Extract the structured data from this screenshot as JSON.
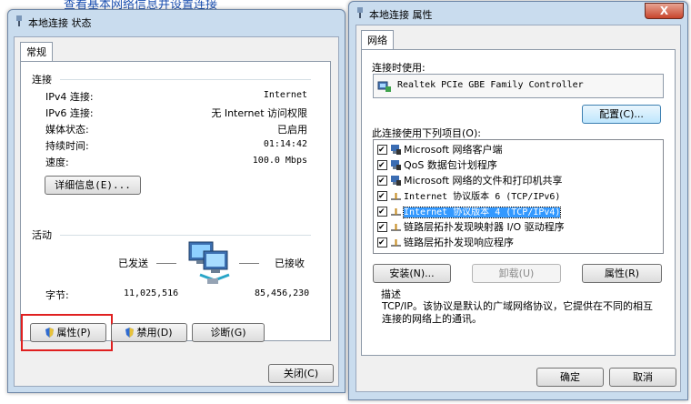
{
  "background": {
    "link_text": "查看基本网络信息并设置连接"
  },
  "status_window": {
    "title": "本地连接 状态",
    "tab": "常规",
    "connection_section": "连接",
    "rows": [
      {
        "label": "IPv4 连接:",
        "value": "Internet"
      },
      {
        "label": "IPv6 连接:",
        "value": "无 Internet 访问权限"
      },
      {
        "label": "媒体状态:",
        "value": "已启用"
      },
      {
        "label": "持续时间:",
        "value": "01:14:42"
      },
      {
        "label": "速度:",
        "value": "100.0 Mbps"
      }
    ],
    "details_button": "详细信息(E)...",
    "activity_section": "活动",
    "sent_label": "已发送",
    "received_label": "已接收",
    "bytes_label": "字节:",
    "bytes_sent": "11,025,516",
    "bytes_received": "85,456,230",
    "properties_button": "属性(P)",
    "disable_button": "禁用(D)",
    "diagnose_button": "诊断(G)",
    "close_button": "关闭(C)"
  },
  "properties_window": {
    "title": "本地连接 属性",
    "close_glyph": "X",
    "tab": "网络",
    "connect_using_label": "连接时使用:",
    "adapter_name": "Realtek PCIe GBE Family Controller",
    "configure_button": "配置(C)...",
    "items_label": "此连接使用下列项目(O):",
    "items": [
      {
        "label": "Microsoft 网络客户端",
        "icon": "network-client-icon",
        "checked": true
      },
      {
        "label": "QoS 数据包计划程序",
        "icon": "qos-icon",
        "checked": true
      },
      {
        "label": "Microsoft 网络的文件和打印机共享",
        "icon": "file-printer-sharing-icon",
        "checked": true
      },
      {
        "label": "Internet 协议版本 6 (TCP/IPv6)",
        "icon": "protocol-icon",
        "checked": true
      },
      {
        "label": "Internet 协议版本 4 (TCP/IPv4)",
        "icon": "protocol-icon",
        "checked": true,
        "selected": true
      },
      {
        "label": "链路层拓扑发现映射器 I/O 驱动程序",
        "icon": "protocol-icon",
        "checked": true
      },
      {
        "label": "链路层拓扑发现响应程序",
        "icon": "protocol-icon",
        "checked": true
      }
    ],
    "install_button": "安装(N)...",
    "uninstall_button": "卸载(U)",
    "properties_button": "属性(R)",
    "description_label": "描述",
    "description_text": "TCP/IP。该协议是默认的广域网络协议，它提供在不同的相互连接的网络上的通讯。",
    "ok_button": "确定",
    "cancel_button": "取消"
  }
}
